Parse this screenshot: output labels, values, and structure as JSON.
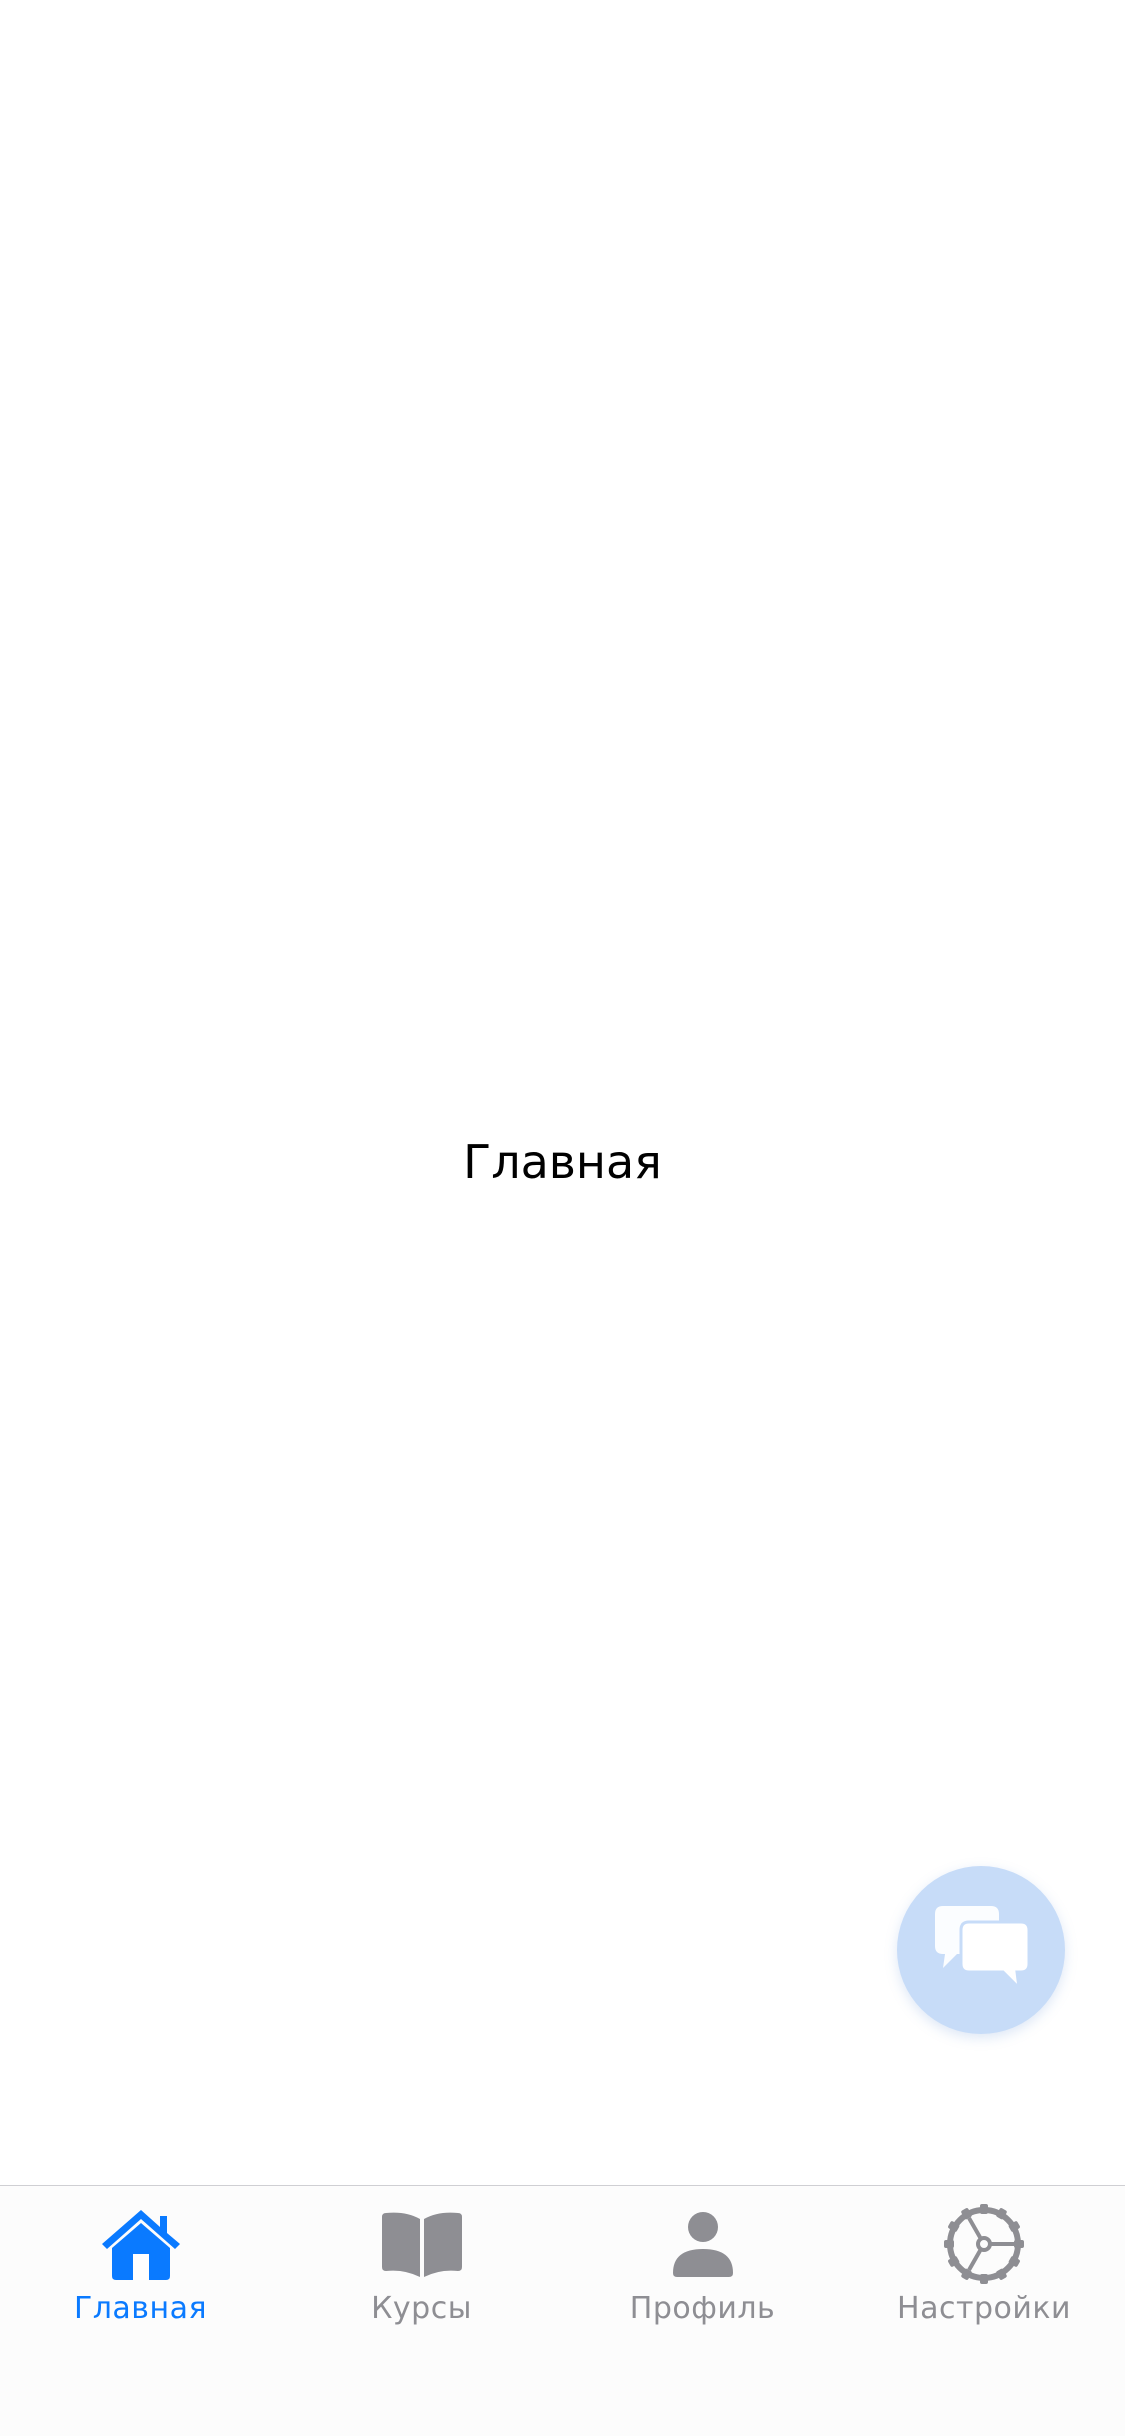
{
  "main": {
    "title": "Главная"
  },
  "chat_button": {
    "icon": "chat-bubbles-icon"
  },
  "tab_bar": {
    "active_color": "#0A7AFF",
    "inactive_color": "#8E8E93",
    "tabs": [
      {
        "label": "Главная",
        "icon": "house-icon",
        "active": true
      },
      {
        "label": "Курсы",
        "icon": "book-icon",
        "active": false
      },
      {
        "label": "Профиль",
        "icon": "person-icon",
        "active": false
      },
      {
        "label": "Настройки",
        "icon": "gear-icon",
        "active": false
      }
    ]
  }
}
